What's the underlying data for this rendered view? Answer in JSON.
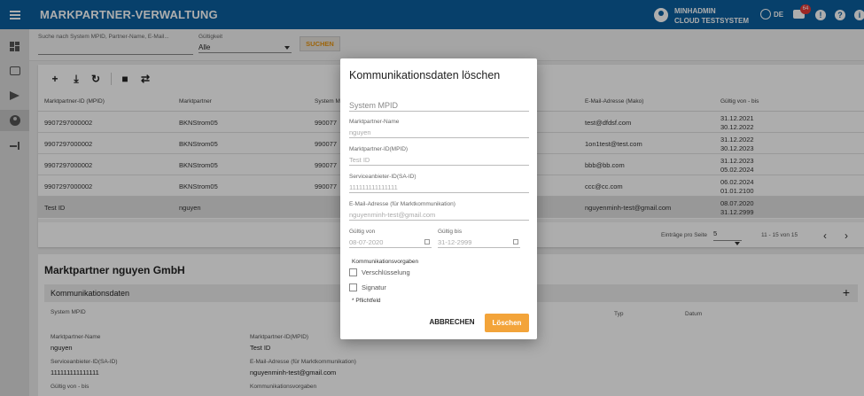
{
  "header": {
    "title": "MARKPARTNER-VERWALTUNG",
    "user_line1": "MINHADMIN",
    "user_line2": "CLOUD TESTSYSTEM",
    "language": "DE",
    "messages_count": "64",
    "color": "#0b5f9e"
  },
  "filter": {
    "search_placeholder": "Suche nach System MPID, Partner-Name, E-Mail...",
    "gueltig_label": "Gültigkeit",
    "gueltig_value": "Alle",
    "search_button": "SUCHEN"
  },
  "table": {
    "columns": [
      "Marktpartner-ID (MPID)",
      "Marktpartner",
      "System M",
      "E-Mail-Adresse (Mako)",
      "Gültig von - bis"
    ],
    "rows": [
      {
        "mpid": "9907297000002",
        "partner": "BKNStrom05",
        "system": "990077",
        "email": "test@dfdsf.com",
        "from": "31.12.2021",
        "to": "30.12.2022"
      },
      {
        "mpid": "9907297000002",
        "partner": "BKNStrom05",
        "system": "990077",
        "email": "1on1test@test.com",
        "from": "31.12.2022",
        "to": "30.12.2023"
      },
      {
        "mpid": "9907297000002",
        "partner": "BKNStrom05",
        "system": "990077",
        "email": "bbb@bb.com",
        "from": "31.12.2023",
        "to": "05.02.2024"
      },
      {
        "mpid": "9907297000002",
        "partner": "BKNStrom05",
        "system": "990077",
        "email": "ccc@cc.com",
        "from": "06.02.2024",
        "to": "01.01.2100"
      },
      {
        "mpid": "Test ID",
        "partner": "nguyen",
        "system": "",
        "email": "nguyenminh-test@gmail.com",
        "from": "08.07.2020",
        "to": "31.12.2999"
      }
    ],
    "pager_label": "Einträge pro Seite",
    "pager_size": "5",
    "pager_range": "11 - 15 von 15"
  },
  "details": {
    "title": "Marktpartner nguyen GmbH",
    "section": "Kommunikationsdaten",
    "col_system": "System MPID",
    "col_typ": "Typ",
    "col_datum": "Datum",
    "name_label": "Marktpartner-Name",
    "name_value": "nguyen",
    "mpid_label": "Marktpartner-ID(MPID)",
    "mpid_value": "Test ID",
    "said_label": "Serviceanbieter-ID(SA-ID)",
    "said_value": "111111111111111",
    "email_label": "E-Mail-Adresse (für Marktkommunikation)",
    "email_value": "nguyenminh-test@gmail.com",
    "gueltig_label": "Gültig von - bis",
    "komm_label": "Kommunikationsvorgaben"
  },
  "modal": {
    "title": "Kommunikationsdaten löschen",
    "system_mpid_placeholder": "System MPID",
    "name_label": "Marktpartner-Name",
    "name_value": "nguyen",
    "mpid_label": "Marktpartner-ID(MPID)",
    "mpid_value": "Test ID",
    "said_label": "Serviceanbieter-ID(SA-ID)",
    "said_value": "111111111111111",
    "email_label": "E-Mail-Adresse (für Marktkommunikation)",
    "email_value": "nguyenminh-test@gmail.com",
    "from_label": "Gültig von",
    "from_value": "08-07-2020",
    "to_label": "Gültig bis",
    "to_value": "31-12-2999",
    "komm_label": "Kommunikationsvorgaben",
    "cb_encrypt": "Verschlüsselung",
    "cb_signature": "Signatur",
    "required_note": "* Pflichtfeld",
    "cancel_button": "ABBRECHEN",
    "delete_button": "Löschen",
    "accent": "#f3a43a"
  }
}
